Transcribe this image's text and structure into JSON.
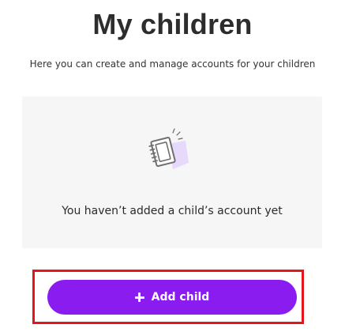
{
  "page": {
    "title": "My children",
    "subtitle": "Here you can create and manage accounts for your children"
  },
  "empty_state": {
    "icon": "notebook-icon",
    "message": "You haven’t added a child’s account yet"
  },
  "actions": {
    "add_child_label": "Add child",
    "add_child_icon": "plus-icon"
  },
  "colors": {
    "accent": "#8a1cf0",
    "highlight": "#e8141b",
    "card_background": "#f6f6f7"
  }
}
